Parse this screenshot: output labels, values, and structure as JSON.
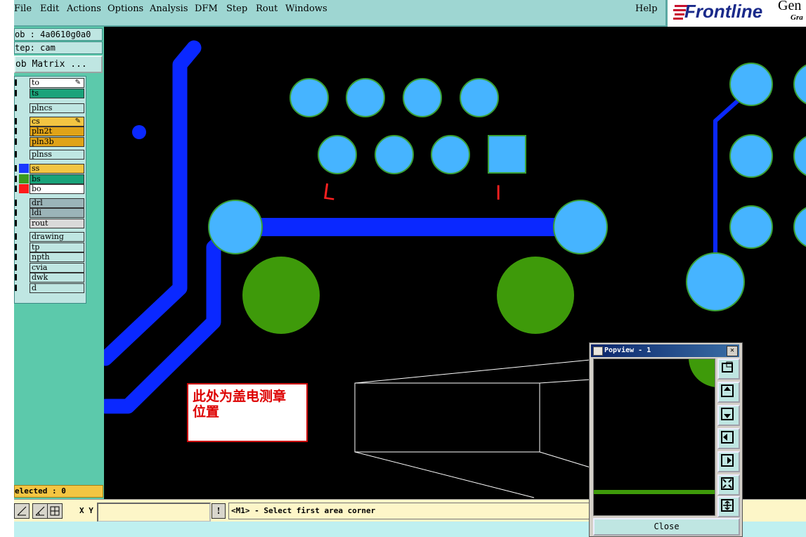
{
  "menu": {
    "file": "File",
    "edit": "Edit",
    "actions": "Actions",
    "options": "Options",
    "analysis": "Analysis",
    "dfm": "DFM",
    "step": "Step",
    "rout": "Rout",
    "windows": "Windows",
    "help": "Help"
  },
  "brand": {
    "name": "Frontline",
    "product_partial": "Gen",
    "tag_partial": "Gra"
  },
  "panel": {
    "job": "ob : 4a0610g0a0",
    "step": "tep: cam",
    "matrix_button": "ob Matrix ..."
  },
  "layers": [
    {
      "name": "to",
      "color": "#ffffff",
      "swatch": "",
      "flag": "pencil"
    },
    {
      "name": "ts",
      "color": "#1aa37a",
      "swatch": ""
    },
    {
      "name": "plncs",
      "color": "#bfe6e2",
      "swatch": ""
    },
    {
      "name": "cs",
      "color": "#f3c542",
      "swatch": "",
      "flag": "pencil"
    },
    {
      "name": "pln2t",
      "color": "#e0a318",
      "swatch": ""
    },
    {
      "name": "pln3b",
      "color": "#e0a318",
      "swatch": ""
    },
    {
      "name": "plnss",
      "color": "#bfe6e2",
      "swatch": ""
    },
    {
      "name": "ss",
      "color": "#f3c542",
      "swatch": "#1a37ff"
    },
    {
      "name": "bs",
      "color": "#1aa37a",
      "swatch": "#3b9a1f"
    },
    {
      "name": "bo",
      "color": "#ffffff",
      "swatch": "#ff1a1a"
    },
    {
      "name": "drl",
      "color": "#9bb4b8",
      "swatch": ""
    },
    {
      "name": "ldi",
      "color": "#9bb4b8",
      "swatch": ""
    },
    {
      "name": "rout",
      "color": "#d9d9d9",
      "swatch": ""
    },
    {
      "name": "drawing",
      "color": "#bfe6e2",
      "swatch": ""
    },
    {
      "name": "tp",
      "color": "#bfe6e2",
      "swatch": ""
    },
    {
      "name": "npth",
      "color": "#bfe6e2",
      "swatch": ""
    },
    {
      "name": "cvia",
      "color": "#bfe6e2",
      "swatch": ""
    },
    {
      "name": "dwk",
      "color": "#bfe6e2",
      "swatch": ""
    },
    {
      "name": "d",
      "color": "#bfe6e2",
      "swatch": ""
    }
  ],
  "selected": "elected : 0",
  "status": {
    "xy_label": "X Y :",
    "xy_value": "",
    "message": "<M1> - Select first area corner"
  },
  "popview": {
    "title": "Popview - 1",
    "close_button": "Close"
  },
  "canvas": {
    "annotation": "此处为盖电测章\n位置",
    "marker_left": "L",
    "marker_right": "I",
    "colors": {
      "trace": "#0a28ff",
      "pad": "#46b4ff",
      "smd": "#3e9a0a",
      "pad_edge": "#3aa034"
    }
  },
  "colors": {
    "menubar": "#9ed6d2",
    "panel": "#5cc9ab",
    "statusbar": "#fdf6c8",
    "accent": "#c8102e"
  }
}
